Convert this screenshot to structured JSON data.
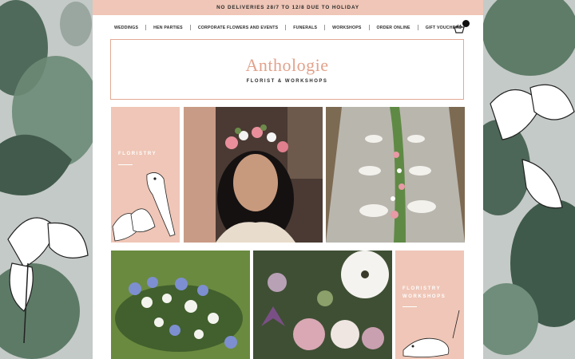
{
  "banner": {
    "text": "NO DELIVERIES 28/7 TO 12/8 DUE TO HOLIDAY"
  },
  "nav": {
    "items": [
      {
        "label": "WEDDINGS"
      },
      {
        "label": "HEN PARTIES"
      },
      {
        "label": "CORPORATE FLOWERS AND EVENTS"
      },
      {
        "label": "FUNERALS"
      },
      {
        "label": "WORKSHOPS"
      },
      {
        "label": "ORDER ONLINE"
      },
      {
        "label": "GIFT VOUCHERS"
      }
    ],
    "cart_icon": "shopping-basket-icon"
  },
  "logo": {
    "title": "Anthologie",
    "subtitle": "FLORIST & WORKSHOPS"
  },
  "tiles": {
    "floristry": {
      "label": "FLORISTRY"
    },
    "floristry_workshops": {
      "label_line1": "FLORISTRY",
      "label_line2": "WORKSHOPS"
    }
  },
  "colors": {
    "accent": "#efc6b7",
    "logo": "#e2a28c"
  }
}
